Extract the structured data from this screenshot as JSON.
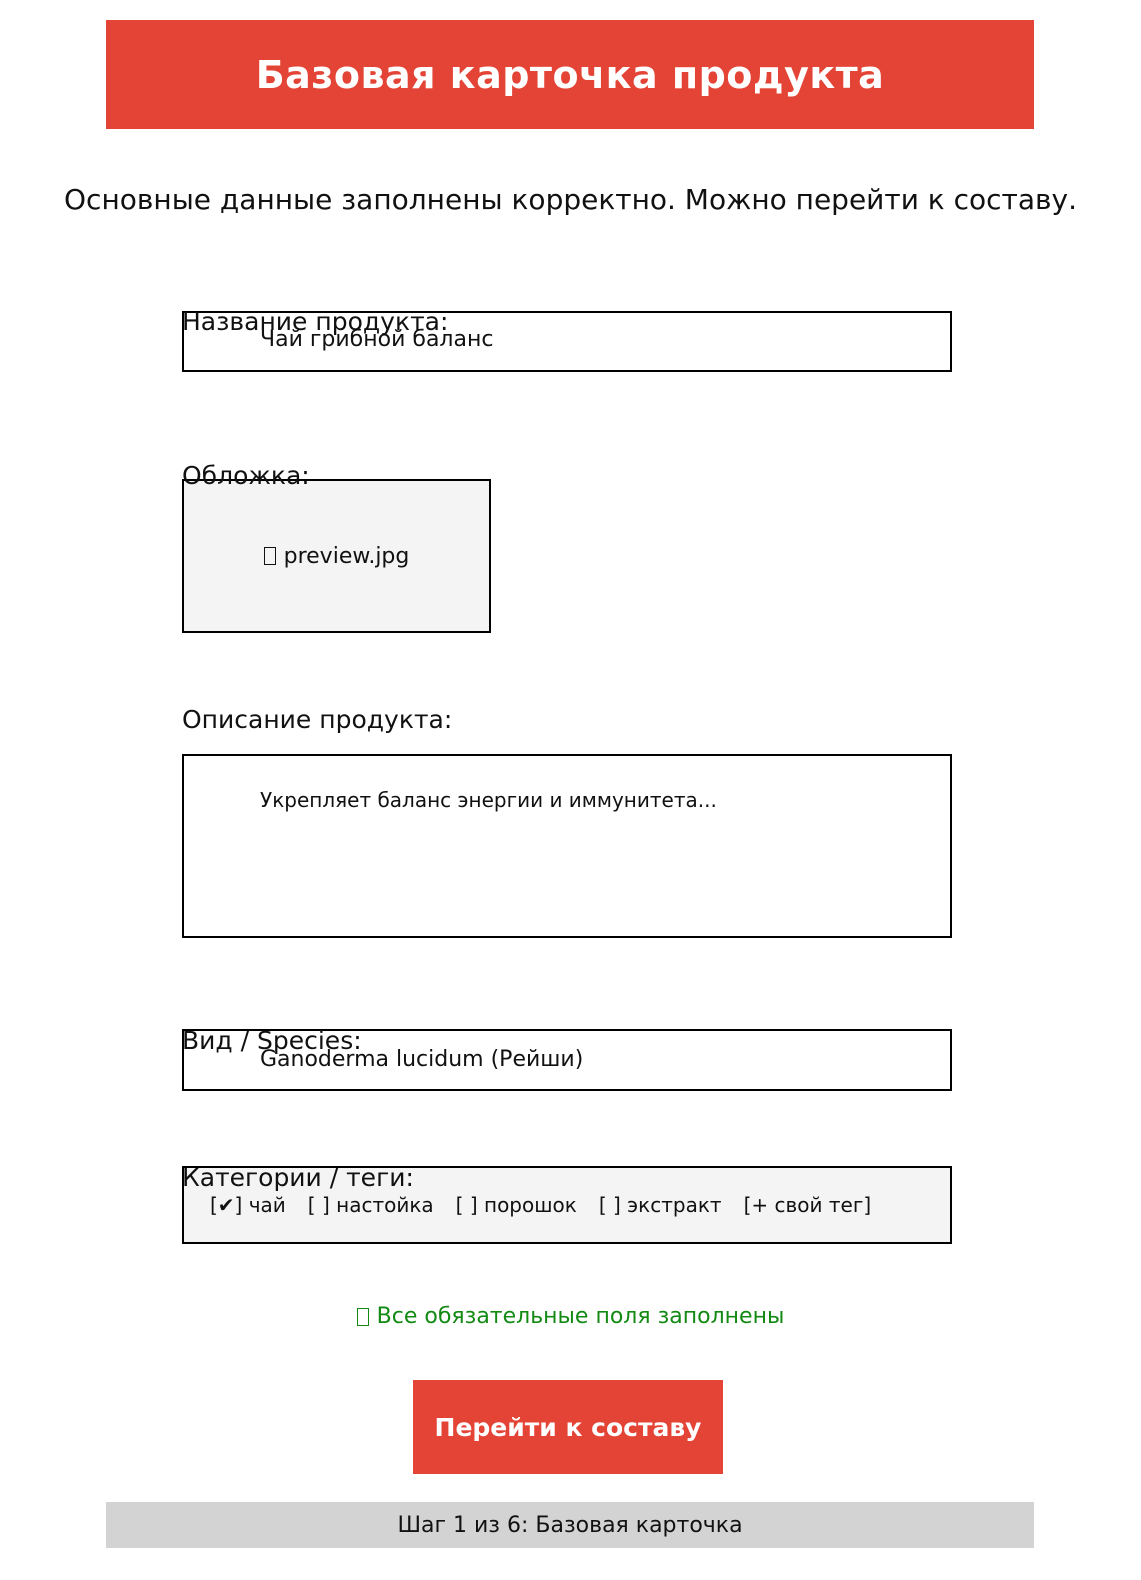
{
  "header": {
    "title": "Базовая карточка продукта"
  },
  "intro": {
    "message": "Основные данные заполнены корректно. Можно перейти к составу."
  },
  "form": {
    "name": {
      "label": "Название продукта:",
      "value": "Чай грибной баланс"
    },
    "cover": {
      "label": "Обложка:",
      "icon": "image-icon",
      "filename": "preview.jpg"
    },
    "description": {
      "label": "Описание продукта:",
      "value": "Укрепляет баланс энергии и иммунитета..."
    },
    "species": {
      "label": "Вид / Species:",
      "value": "Ganoderma lucidum (Рейши)"
    },
    "tags": {
      "label": "Категории / теги:",
      "items": [
        {
          "text": "[✔] чай",
          "checked": true
        },
        {
          "text": "[ ] настойка",
          "checked": false
        },
        {
          "text": "[ ] порошок",
          "checked": false
        },
        {
          "text": "[ ] экстракт",
          "checked": false
        },
        {
          "text": "[+ свой тег]",
          "checked": false
        }
      ]
    }
  },
  "validation": {
    "icon": "check-icon",
    "message": "Все обязательные поля заполнены",
    "color": "#138a13"
  },
  "actions": {
    "next_label": "Перейти к составу"
  },
  "footer": {
    "step_text": "Шаг 1 из 6: Базовая карточка"
  },
  "colors": {
    "accent": "#e44436",
    "footer_bg": "#d3d3d3",
    "field_bg_alt": "#f4f4f4"
  }
}
